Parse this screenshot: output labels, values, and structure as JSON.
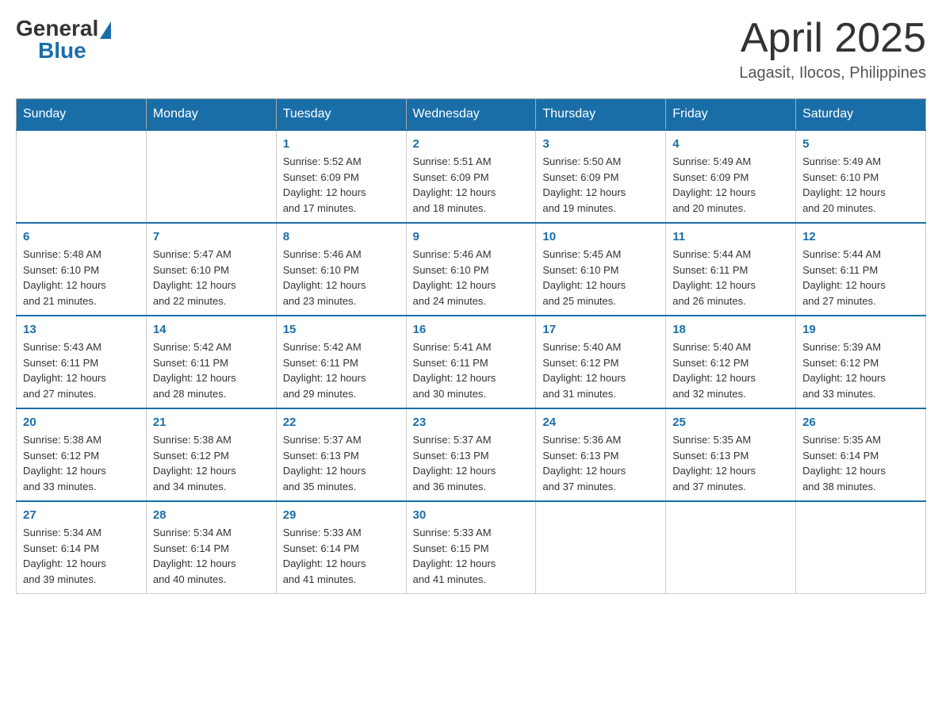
{
  "header": {
    "logo": {
      "text_general": "General",
      "text_blue": "Blue"
    },
    "title": "April 2025",
    "location": "Lagasit, Ilocos, Philippines"
  },
  "calendar": {
    "days_of_week": [
      "Sunday",
      "Monday",
      "Tuesday",
      "Wednesday",
      "Thursday",
      "Friday",
      "Saturday"
    ],
    "weeks": [
      [
        {
          "day": "",
          "info": ""
        },
        {
          "day": "",
          "info": ""
        },
        {
          "day": "1",
          "info": "Sunrise: 5:52 AM\nSunset: 6:09 PM\nDaylight: 12 hours\nand 17 minutes."
        },
        {
          "day": "2",
          "info": "Sunrise: 5:51 AM\nSunset: 6:09 PM\nDaylight: 12 hours\nand 18 minutes."
        },
        {
          "day": "3",
          "info": "Sunrise: 5:50 AM\nSunset: 6:09 PM\nDaylight: 12 hours\nand 19 minutes."
        },
        {
          "day": "4",
          "info": "Sunrise: 5:49 AM\nSunset: 6:09 PM\nDaylight: 12 hours\nand 20 minutes."
        },
        {
          "day": "5",
          "info": "Sunrise: 5:49 AM\nSunset: 6:10 PM\nDaylight: 12 hours\nand 20 minutes."
        }
      ],
      [
        {
          "day": "6",
          "info": "Sunrise: 5:48 AM\nSunset: 6:10 PM\nDaylight: 12 hours\nand 21 minutes."
        },
        {
          "day": "7",
          "info": "Sunrise: 5:47 AM\nSunset: 6:10 PM\nDaylight: 12 hours\nand 22 minutes."
        },
        {
          "day": "8",
          "info": "Sunrise: 5:46 AM\nSunset: 6:10 PM\nDaylight: 12 hours\nand 23 minutes."
        },
        {
          "day": "9",
          "info": "Sunrise: 5:46 AM\nSunset: 6:10 PM\nDaylight: 12 hours\nand 24 minutes."
        },
        {
          "day": "10",
          "info": "Sunrise: 5:45 AM\nSunset: 6:10 PM\nDaylight: 12 hours\nand 25 minutes."
        },
        {
          "day": "11",
          "info": "Sunrise: 5:44 AM\nSunset: 6:11 PM\nDaylight: 12 hours\nand 26 minutes."
        },
        {
          "day": "12",
          "info": "Sunrise: 5:44 AM\nSunset: 6:11 PM\nDaylight: 12 hours\nand 27 minutes."
        }
      ],
      [
        {
          "day": "13",
          "info": "Sunrise: 5:43 AM\nSunset: 6:11 PM\nDaylight: 12 hours\nand 27 minutes."
        },
        {
          "day": "14",
          "info": "Sunrise: 5:42 AM\nSunset: 6:11 PM\nDaylight: 12 hours\nand 28 minutes."
        },
        {
          "day": "15",
          "info": "Sunrise: 5:42 AM\nSunset: 6:11 PM\nDaylight: 12 hours\nand 29 minutes."
        },
        {
          "day": "16",
          "info": "Sunrise: 5:41 AM\nSunset: 6:11 PM\nDaylight: 12 hours\nand 30 minutes."
        },
        {
          "day": "17",
          "info": "Sunrise: 5:40 AM\nSunset: 6:12 PM\nDaylight: 12 hours\nand 31 minutes."
        },
        {
          "day": "18",
          "info": "Sunrise: 5:40 AM\nSunset: 6:12 PM\nDaylight: 12 hours\nand 32 minutes."
        },
        {
          "day": "19",
          "info": "Sunrise: 5:39 AM\nSunset: 6:12 PM\nDaylight: 12 hours\nand 33 minutes."
        }
      ],
      [
        {
          "day": "20",
          "info": "Sunrise: 5:38 AM\nSunset: 6:12 PM\nDaylight: 12 hours\nand 33 minutes."
        },
        {
          "day": "21",
          "info": "Sunrise: 5:38 AM\nSunset: 6:12 PM\nDaylight: 12 hours\nand 34 minutes."
        },
        {
          "day": "22",
          "info": "Sunrise: 5:37 AM\nSunset: 6:13 PM\nDaylight: 12 hours\nand 35 minutes."
        },
        {
          "day": "23",
          "info": "Sunrise: 5:37 AM\nSunset: 6:13 PM\nDaylight: 12 hours\nand 36 minutes."
        },
        {
          "day": "24",
          "info": "Sunrise: 5:36 AM\nSunset: 6:13 PM\nDaylight: 12 hours\nand 37 minutes."
        },
        {
          "day": "25",
          "info": "Sunrise: 5:35 AM\nSunset: 6:13 PM\nDaylight: 12 hours\nand 37 minutes."
        },
        {
          "day": "26",
          "info": "Sunrise: 5:35 AM\nSunset: 6:14 PM\nDaylight: 12 hours\nand 38 minutes."
        }
      ],
      [
        {
          "day": "27",
          "info": "Sunrise: 5:34 AM\nSunset: 6:14 PM\nDaylight: 12 hours\nand 39 minutes."
        },
        {
          "day": "28",
          "info": "Sunrise: 5:34 AM\nSunset: 6:14 PM\nDaylight: 12 hours\nand 40 minutes."
        },
        {
          "day": "29",
          "info": "Sunrise: 5:33 AM\nSunset: 6:14 PM\nDaylight: 12 hours\nand 41 minutes."
        },
        {
          "day": "30",
          "info": "Sunrise: 5:33 AM\nSunset: 6:15 PM\nDaylight: 12 hours\nand 41 minutes."
        },
        {
          "day": "",
          "info": ""
        },
        {
          "day": "",
          "info": ""
        },
        {
          "day": "",
          "info": ""
        }
      ]
    ]
  }
}
